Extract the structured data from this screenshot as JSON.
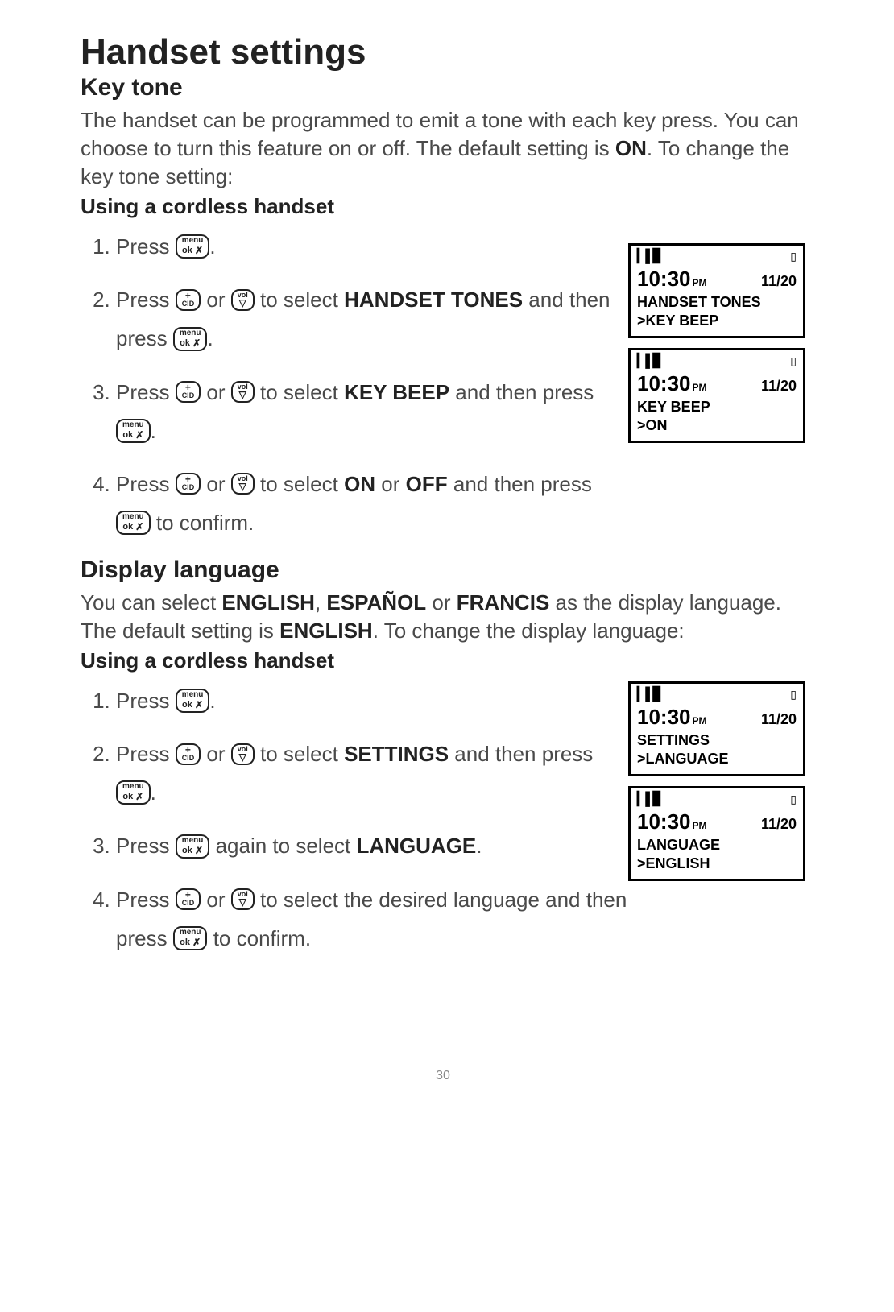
{
  "page_number": "30",
  "h1": "Handset settings",
  "section1": {
    "title": "Key tone",
    "intro_parts": {
      "p1a": "The handset can be programmed to emit a tone with each key press. You can choose to turn this feature on or off. The default setting is ",
      "on": "ON",
      "p1b": ". To change the key tone setting:"
    },
    "sub": "Using a cordless handset",
    "steps": {
      "s1a": "Press ",
      "s1b": ".",
      "s2a": "Press ",
      "s2b": " or ",
      "s2c": " to select ",
      "s2d": "HANDSET TONES",
      "s2e": " and then press ",
      "s2f": ".",
      "s3a": "Press ",
      "s3b": " or ",
      "s3c": " to select ",
      "s3d": "KEY BEEP",
      "s3e": " and then press ",
      "s3f": ".",
      "s4a": "Press ",
      "s4b": " or ",
      "s4c": " to select ",
      "s4d": "ON",
      "s4e": " or ",
      "s4f": "OFF",
      "s4g": " and then press ",
      "s4h": " to confirm."
    },
    "lcd1": {
      "time": "10:30",
      "pm": "PM",
      "date": "11/20",
      "l1": "HANDSET TONES",
      "l2": ">KEY BEEP"
    },
    "lcd2": {
      "time": "10:30",
      "pm": "PM",
      "date": "11/20",
      "l1": "KEY BEEP",
      "l2": ">ON"
    }
  },
  "section2": {
    "title": "Display language",
    "intro_parts": {
      "p1a": "You can select ",
      "en": "ENGLISH",
      "c1": ", ",
      "es": "ESPAÑOL",
      "c2": " or ",
      "fr": "FRANCIS",
      "p1b": " as the display language. The default setting is ",
      "en2": "ENGLISH",
      "p1c": ". To change the display language:"
    },
    "sub": "Using a cordless handset",
    "steps": {
      "s1a": "Press ",
      "s1b": ".",
      "s2a": "Press ",
      "s2b": " or ",
      "s2c": " to select ",
      "s2d": "SETTINGS",
      "s2e": " and then press ",
      "s2f": ".",
      "s3a": "Press ",
      "s3b": " again to select ",
      "s3c": "LANGUAGE",
      "s3d": ".",
      "s4a": "Press ",
      "s4b": " or ",
      "s4c": " to select the desired language and then press ",
      "s4d": " to confirm."
    },
    "lcd1": {
      "time": "10:30",
      "pm": "PM",
      "date": "11/20",
      "l1": "SETTINGS",
      "l2": ">LANGUAGE"
    },
    "lcd2": {
      "time": "10:30",
      "pm": "PM",
      "date": "11/20",
      "l1": "LANGUAGE",
      "l2": ">ENGLISH"
    }
  },
  "buttons": {
    "menu_l1": "menu",
    "menu_l2": "ok",
    "cid_plus": "+",
    "cid_cid": "CID",
    "vol_vol": "vol",
    "vol_down": "▽"
  },
  "lcd_icons": {
    "signal": "▮▮▮",
    "battery": "▮"
  }
}
